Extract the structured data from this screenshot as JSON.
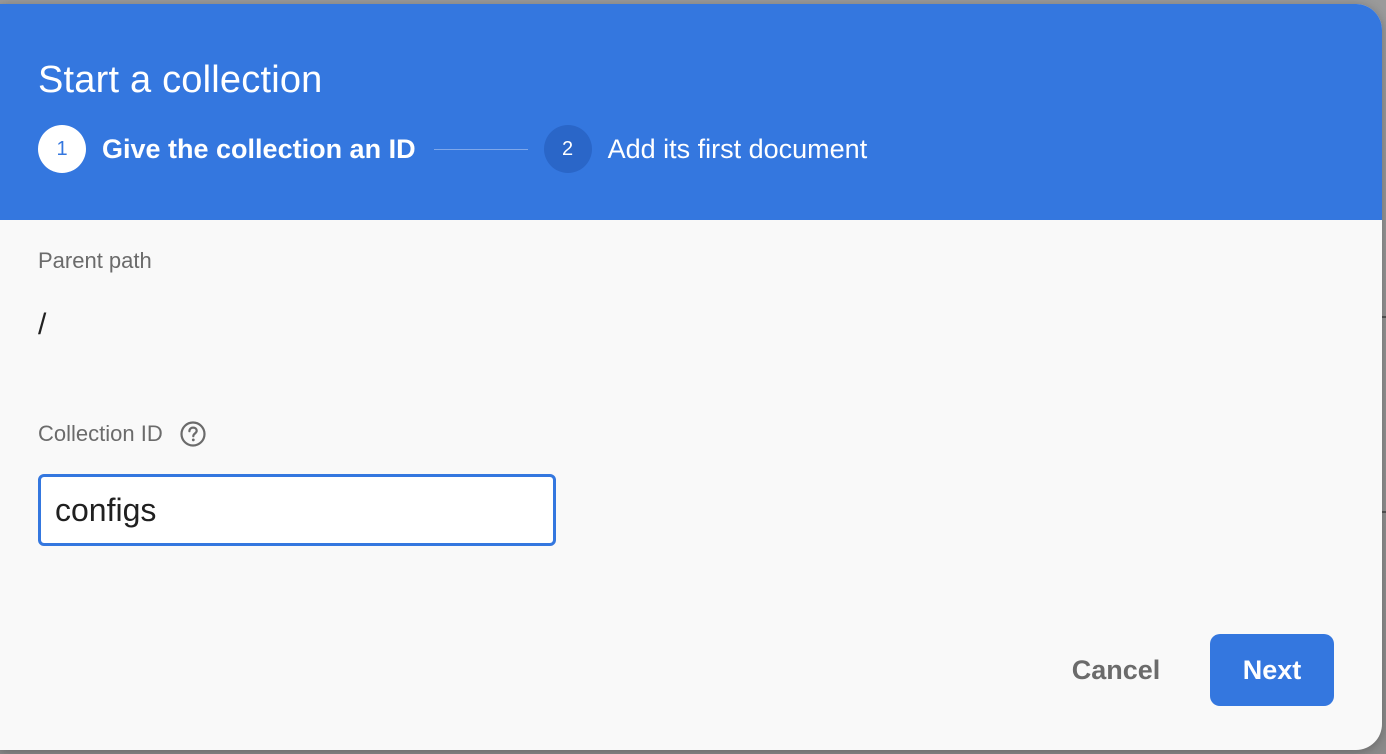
{
  "dialog": {
    "title": "Start a collection",
    "steps": [
      {
        "number": "1",
        "label": "Give the collection an ID",
        "state": "active"
      },
      {
        "number": "2",
        "label": "Add its first document",
        "state": "inactive"
      }
    ]
  },
  "form": {
    "parent_path": {
      "label": "Parent path",
      "value": "/"
    },
    "collection_id": {
      "label": "Collection ID",
      "help_icon": "help-circle-icon",
      "value": "configs"
    }
  },
  "actions": {
    "cancel_label": "Cancel",
    "next_label": "Next"
  },
  "colors": {
    "accent": "#3477df",
    "header_bg": "#3477df",
    "inactive_step": "#2a66c8",
    "body_bg": "#f9f9f9"
  }
}
